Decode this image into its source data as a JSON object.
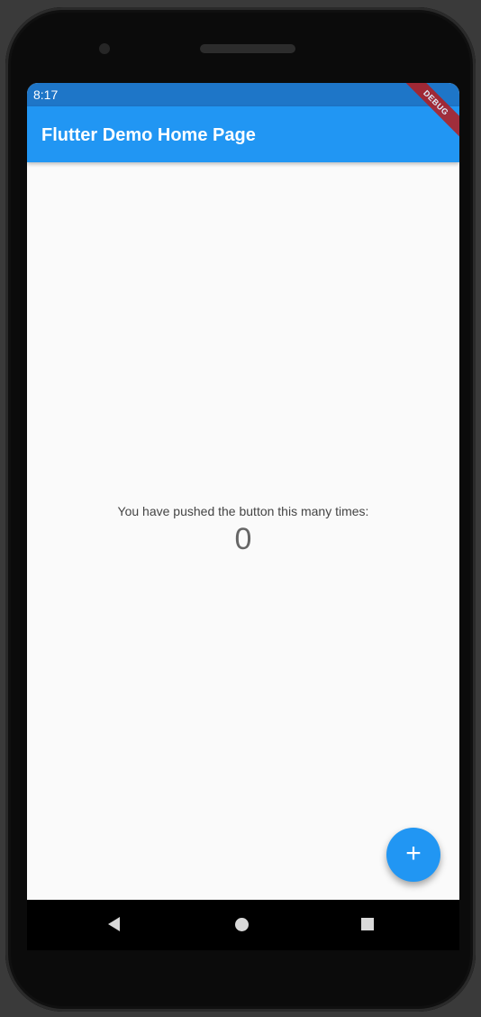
{
  "status_bar": {
    "time": "8:17"
  },
  "app_bar": {
    "title": "Flutter Demo Home Page",
    "debug_banner": "DEBUG"
  },
  "body": {
    "counter_label": "You have pushed the button this many times:",
    "counter_value": "0"
  },
  "fab": {
    "icon": "add-icon",
    "glyph": "+"
  },
  "navigation": {
    "back_icon": "back-triangle-icon",
    "home_icon": "home-circle-icon",
    "recents_icon": "recents-square-icon"
  },
  "colors": {
    "primary": "#2196f3",
    "status_bar": "#1e76c8",
    "background": "#fafafa",
    "debug_banner": "#b71c1c"
  }
}
